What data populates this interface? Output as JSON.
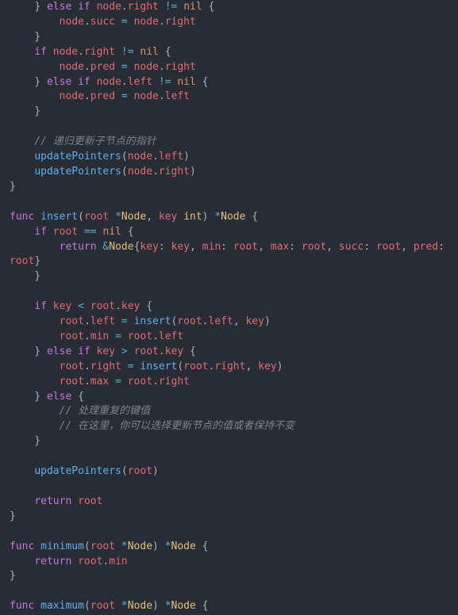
{
  "code": {
    "tokens": [
      [
        "p",
        "    "
      ],
      [
        "p",
        "} "
      ],
      [
        "k",
        "else"
      ],
      [
        "p",
        " "
      ],
      [
        "k",
        "if"
      ],
      [
        "p",
        " "
      ],
      [
        "v",
        "node"
      ],
      [
        "p",
        "."
      ],
      [
        "v",
        "right"
      ],
      [
        "p",
        " "
      ],
      [
        "op",
        "!="
      ],
      [
        "p",
        " "
      ],
      [
        "nl",
        "nil"
      ],
      [
        "p",
        " {"
      ],
      [
        "br",
        ""
      ],
      [
        "p",
        "        "
      ],
      [
        "v",
        "node"
      ],
      [
        "p",
        "."
      ],
      [
        "v",
        "succ"
      ],
      [
        "p",
        " "
      ],
      [
        "op",
        "="
      ],
      [
        "p",
        " "
      ],
      [
        "v",
        "node"
      ],
      [
        "p",
        "."
      ],
      [
        "v",
        "right"
      ],
      [
        "br",
        ""
      ],
      [
        "p",
        "    }"
      ],
      [
        "br",
        ""
      ],
      [
        "p",
        "    "
      ],
      [
        "k",
        "if"
      ],
      [
        "p",
        " "
      ],
      [
        "v",
        "node"
      ],
      [
        "p",
        "."
      ],
      [
        "v",
        "right"
      ],
      [
        "p",
        " "
      ],
      [
        "op",
        "!="
      ],
      [
        "p",
        " "
      ],
      [
        "nl",
        "nil"
      ],
      [
        "p",
        " {"
      ],
      [
        "br",
        ""
      ],
      [
        "p",
        "        "
      ],
      [
        "v",
        "node"
      ],
      [
        "p",
        "."
      ],
      [
        "v",
        "pred"
      ],
      [
        "p",
        " "
      ],
      [
        "op",
        "="
      ],
      [
        "p",
        " "
      ],
      [
        "v",
        "node"
      ],
      [
        "p",
        "."
      ],
      [
        "v",
        "right"
      ],
      [
        "br",
        ""
      ],
      [
        "p",
        "    } "
      ],
      [
        "k",
        "else"
      ],
      [
        "p",
        " "
      ],
      [
        "k",
        "if"
      ],
      [
        "p",
        " "
      ],
      [
        "v",
        "node"
      ],
      [
        "p",
        "."
      ],
      [
        "v",
        "left"
      ],
      [
        "p",
        " "
      ],
      [
        "op",
        "!="
      ],
      [
        "p",
        " "
      ],
      [
        "nl",
        "nil"
      ],
      [
        "p",
        " {"
      ],
      [
        "br",
        ""
      ],
      [
        "p",
        "        "
      ],
      [
        "v",
        "node"
      ],
      [
        "p",
        "."
      ],
      [
        "v",
        "pred"
      ],
      [
        "p",
        " "
      ],
      [
        "op",
        "="
      ],
      [
        "p",
        " "
      ],
      [
        "v",
        "node"
      ],
      [
        "p",
        "."
      ],
      [
        "v",
        "left"
      ],
      [
        "br",
        ""
      ],
      [
        "p",
        "    }"
      ],
      [
        "br",
        ""
      ],
      [
        "br",
        ""
      ],
      [
        "p",
        "    "
      ],
      [
        "c",
        "// 递归更新子节点的指针"
      ],
      [
        "br",
        ""
      ],
      [
        "p",
        "    "
      ],
      [
        "fn",
        "updatePointers"
      ],
      [
        "p",
        "("
      ],
      [
        "v",
        "node"
      ],
      [
        "p",
        "."
      ],
      [
        "v",
        "left"
      ],
      [
        "p",
        ")"
      ],
      [
        "br",
        ""
      ],
      [
        "p",
        "    "
      ],
      [
        "fn",
        "updatePointers"
      ],
      [
        "p",
        "("
      ],
      [
        "v",
        "node"
      ],
      [
        "p",
        "."
      ],
      [
        "v",
        "right"
      ],
      [
        "p",
        ")"
      ],
      [
        "br",
        ""
      ],
      [
        "p",
        "}"
      ],
      [
        "br",
        ""
      ],
      [
        "br",
        ""
      ],
      [
        "k",
        "func"
      ],
      [
        "p",
        " "
      ],
      [
        "fn",
        "insert"
      ],
      [
        "p",
        "("
      ],
      [
        "v",
        "root"
      ],
      [
        "p",
        " "
      ],
      [
        "op",
        "*"
      ],
      [
        "t",
        "Node"
      ],
      [
        "p",
        ", "
      ],
      [
        "v",
        "key"
      ],
      [
        "p",
        " "
      ],
      [
        "t",
        "int"
      ],
      [
        "p",
        ") "
      ],
      [
        "op",
        "*"
      ],
      [
        "t",
        "Node"
      ],
      [
        "p",
        " {"
      ],
      [
        "br",
        ""
      ],
      [
        "p",
        "    "
      ],
      [
        "k",
        "if"
      ],
      [
        "p",
        " "
      ],
      [
        "v",
        "root"
      ],
      [
        "p",
        " "
      ],
      [
        "op",
        "=="
      ],
      [
        "p",
        " "
      ],
      [
        "nl",
        "nil"
      ],
      [
        "p",
        " {"
      ],
      [
        "br",
        ""
      ],
      [
        "p",
        "        "
      ],
      [
        "k",
        "return"
      ],
      [
        "p",
        " "
      ],
      [
        "op",
        "&"
      ],
      [
        "t",
        "Node"
      ],
      [
        "p",
        "{"
      ],
      [
        "v",
        "key"
      ],
      [
        "p",
        ": "
      ],
      [
        "v",
        "key"
      ],
      [
        "p",
        ", "
      ],
      [
        "v",
        "min"
      ],
      [
        "p",
        ": "
      ],
      [
        "v",
        "root"
      ],
      [
        "p",
        ", "
      ],
      [
        "v",
        "max"
      ],
      [
        "p",
        ": "
      ],
      [
        "v",
        "root"
      ],
      [
        "p",
        ", "
      ],
      [
        "v",
        "succ"
      ],
      [
        "p",
        ": "
      ],
      [
        "v",
        "root"
      ],
      [
        "p",
        ", "
      ],
      [
        "v",
        "pred"
      ],
      [
        "p",
        ": "
      ],
      [
        "br",
        ""
      ],
      [
        "v",
        "root"
      ],
      [
        "p",
        "}"
      ],
      [
        "br",
        ""
      ],
      [
        "p",
        "    }"
      ],
      [
        "br",
        ""
      ],
      [
        "br",
        ""
      ],
      [
        "p",
        "    "
      ],
      [
        "k",
        "if"
      ],
      [
        "p",
        " "
      ],
      [
        "v",
        "key"
      ],
      [
        "p",
        " "
      ],
      [
        "op",
        "<"
      ],
      [
        "p",
        " "
      ],
      [
        "v",
        "root"
      ],
      [
        "p",
        "."
      ],
      [
        "v",
        "key"
      ],
      [
        "p",
        " {"
      ],
      [
        "br",
        ""
      ],
      [
        "p",
        "        "
      ],
      [
        "v",
        "root"
      ],
      [
        "p",
        "."
      ],
      [
        "v",
        "left"
      ],
      [
        "p",
        " "
      ],
      [
        "op",
        "="
      ],
      [
        "p",
        " "
      ],
      [
        "fn",
        "insert"
      ],
      [
        "p",
        "("
      ],
      [
        "v",
        "root"
      ],
      [
        "p",
        "."
      ],
      [
        "v",
        "left"
      ],
      [
        "p",
        ", "
      ],
      [
        "v",
        "key"
      ],
      [
        "p",
        ")"
      ],
      [
        "br",
        ""
      ],
      [
        "p",
        "        "
      ],
      [
        "v",
        "root"
      ],
      [
        "p",
        "."
      ],
      [
        "v",
        "min"
      ],
      [
        "p",
        " "
      ],
      [
        "op",
        "="
      ],
      [
        "p",
        " "
      ],
      [
        "v",
        "root"
      ],
      [
        "p",
        "."
      ],
      [
        "v",
        "left"
      ],
      [
        "br",
        ""
      ],
      [
        "p",
        "    } "
      ],
      [
        "k",
        "else"
      ],
      [
        "p",
        " "
      ],
      [
        "k",
        "if"
      ],
      [
        "p",
        " "
      ],
      [
        "v",
        "key"
      ],
      [
        "p",
        " "
      ],
      [
        "op",
        ">"
      ],
      [
        "p",
        " "
      ],
      [
        "v",
        "root"
      ],
      [
        "p",
        "."
      ],
      [
        "v",
        "key"
      ],
      [
        "p",
        " {"
      ],
      [
        "br",
        ""
      ],
      [
        "p",
        "        "
      ],
      [
        "v",
        "root"
      ],
      [
        "p",
        "."
      ],
      [
        "v",
        "right"
      ],
      [
        "p",
        " "
      ],
      [
        "op",
        "="
      ],
      [
        "p",
        " "
      ],
      [
        "fn",
        "insert"
      ],
      [
        "p",
        "("
      ],
      [
        "v",
        "root"
      ],
      [
        "p",
        "."
      ],
      [
        "v",
        "right"
      ],
      [
        "p",
        ", "
      ],
      [
        "v",
        "key"
      ],
      [
        "p",
        ")"
      ],
      [
        "br",
        ""
      ],
      [
        "p",
        "        "
      ],
      [
        "v",
        "root"
      ],
      [
        "p",
        "."
      ],
      [
        "v",
        "max"
      ],
      [
        "p",
        " "
      ],
      [
        "op",
        "="
      ],
      [
        "p",
        " "
      ],
      [
        "v",
        "root"
      ],
      [
        "p",
        "."
      ],
      [
        "v",
        "right"
      ],
      [
        "br",
        ""
      ],
      [
        "p",
        "    } "
      ],
      [
        "k",
        "else"
      ],
      [
        "p",
        " {"
      ],
      [
        "br",
        ""
      ],
      [
        "p",
        "        "
      ],
      [
        "c",
        "// 处理重复的键值"
      ],
      [
        "br",
        ""
      ],
      [
        "p",
        "        "
      ],
      [
        "c",
        "// 在这里，你可以选择更新节点的值或者保持不变"
      ],
      [
        "br",
        ""
      ],
      [
        "p",
        "    }"
      ],
      [
        "br",
        ""
      ],
      [
        "br",
        ""
      ],
      [
        "p",
        "    "
      ],
      [
        "fn",
        "updatePointers"
      ],
      [
        "p",
        "("
      ],
      [
        "v",
        "root"
      ],
      [
        "p",
        ")"
      ],
      [
        "br",
        ""
      ],
      [
        "br",
        ""
      ],
      [
        "p",
        "    "
      ],
      [
        "k",
        "return"
      ],
      [
        "p",
        " "
      ],
      [
        "v",
        "root"
      ],
      [
        "br",
        ""
      ],
      [
        "p",
        "}"
      ],
      [
        "br",
        ""
      ],
      [
        "br",
        ""
      ],
      [
        "k",
        "func"
      ],
      [
        "p",
        " "
      ],
      [
        "fn",
        "minimum"
      ],
      [
        "p",
        "("
      ],
      [
        "v",
        "root"
      ],
      [
        "p",
        " "
      ],
      [
        "op",
        "*"
      ],
      [
        "t",
        "Node"
      ],
      [
        "p",
        ") "
      ],
      [
        "op",
        "*"
      ],
      [
        "t",
        "Node"
      ],
      [
        "p",
        " {"
      ],
      [
        "br",
        ""
      ],
      [
        "p",
        "    "
      ],
      [
        "k",
        "return"
      ],
      [
        "p",
        " "
      ],
      [
        "v",
        "root"
      ],
      [
        "p",
        "."
      ],
      [
        "v",
        "min"
      ],
      [
        "br",
        ""
      ],
      [
        "p",
        "}"
      ],
      [
        "br",
        ""
      ],
      [
        "br",
        ""
      ],
      [
        "k",
        "func"
      ],
      [
        "p",
        " "
      ],
      [
        "fn",
        "maximum"
      ],
      [
        "p",
        "("
      ],
      [
        "v",
        "root"
      ],
      [
        "p",
        " "
      ],
      [
        "op",
        "*"
      ],
      [
        "t",
        "Node"
      ],
      [
        "p",
        ") "
      ],
      [
        "op",
        "*"
      ],
      [
        "t",
        "Node"
      ],
      [
        "p",
        " {"
      ]
    ]
  }
}
